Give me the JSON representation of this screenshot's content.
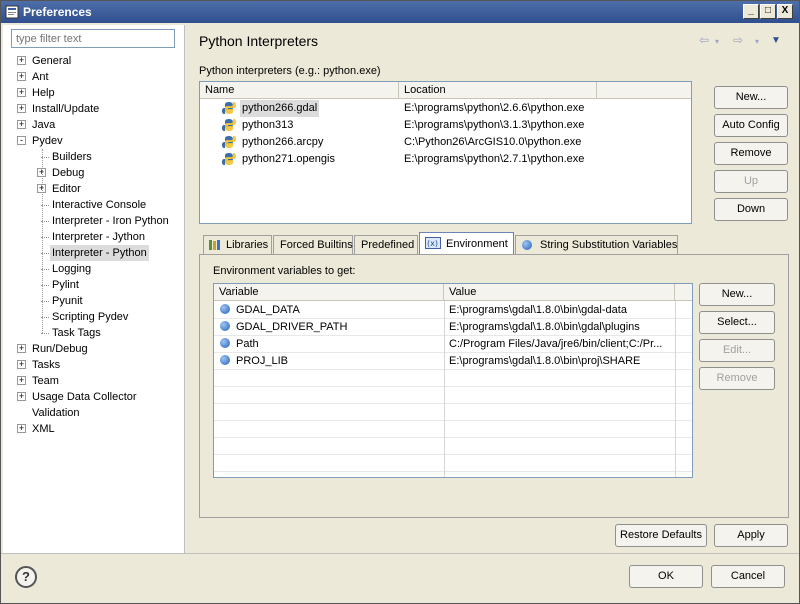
{
  "window": {
    "title": "Preferences",
    "controls": [
      "_",
      "□",
      "X"
    ]
  },
  "filter": {
    "placeholder": "type filter text"
  },
  "tree": [
    {
      "label": "General",
      "level": 0,
      "expander": "+"
    },
    {
      "label": "Ant",
      "level": 0,
      "expander": "+"
    },
    {
      "label": "Help",
      "level": 0,
      "expander": "+"
    },
    {
      "label": "Install/Update",
      "level": 0,
      "expander": "+"
    },
    {
      "label": "Java",
      "level": 0,
      "expander": "+"
    },
    {
      "label": "Pydev",
      "level": 0,
      "expander": "-"
    },
    {
      "label": "Builders",
      "level": 1,
      "expander": ""
    },
    {
      "label": "Debug",
      "level": 1,
      "expander": "+"
    },
    {
      "label": "Editor",
      "level": 1,
      "expander": "+"
    },
    {
      "label": "Interactive Console",
      "level": 1,
      "expander": ""
    },
    {
      "label": "Interpreter - Iron Python",
      "level": 1,
      "expander": ""
    },
    {
      "label": "Interpreter - Jython",
      "level": 1,
      "expander": ""
    },
    {
      "label": "Interpreter - Python",
      "level": 1,
      "expander": "",
      "selected": true
    },
    {
      "label": "Logging",
      "level": 1,
      "expander": ""
    },
    {
      "label": "Pylint",
      "level": 1,
      "expander": ""
    },
    {
      "label": "Pyunit",
      "level": 1,
      "expander": ""
    },
    {
      "label": "Scripting Pydev",
      "level": 1,
      "expander": ""
    },
    {
      "label": "Task Tags",
      "level": 1,
      "expander": ""
    },
    {
      "label": "Run/Debug",
      "level": 0,
      "expander": "+"
    },
    {
      "label": "Tasks",
      "level": 0,
      "expander": "+"
    },
    {
      "label": "Team",
      "level": 0,
      "expander": "+"
    },
    {
      "label": "Usage Data Collector",
      "level": 0,
      "expander": "+"
    },
    {
      "label": "Validation",
      "level": 0,
      "expander": ""
    },
    {
      "label": "XML",
      "level": 0,
      "expander": "+"
    }
  ],
  "page": {
    "title": "Python Interpreters",
    "nav": {
      "back": "⇦",
      "forward": "⇨",
      "menu": "▼"
    },
    "interpreters_label": "Python interpreters (e.g.: python.exe)",
    "interpreters_columns": [
      "Name",
      "Location"
    ],
    "interpreters": [
      {
        "name": "python266.gdal",
        "location": "E:\\programs\\python\\2.6.6\\python.exe",
        "selected": true
      },
      {
        "name": "python313",
        "location": "E:\\programs\\python\\3.1.3\\python.exe"
      },
      {
        "name": "python266.arcpy",
        "location": "C:\\Python26\\ArcGIS10.0\\python.exe"
      },
      {
        "name": "python271.opengis",
        "location": "E:\\programs\\python\\2.7.1\\python.exe"
      }
    ],
    "interpreter_buttons": {
      "new": "New...",
      "auto_config": "Auto Config",
      "remove": "Remove",
      "up": "Up",
      "down": "Down"
    },
    "tabs": [
      {
        "label": "Libraries",
        "icon": "libraries-icon"
      },
      {
        "label": "Forced Builtins",
        "icon": ""
      },
      {
        "label": "Predefined",
        "icon": ""
      },
      {
        "label": "Environment",
        "icon": "environment-icon",
        "active": true
      },
      {
        "label": "String Substitution Variables",
        "icon": "variable-icon"
      }
    ],
    "env_label": "Environment variables to get:",
    "env_columns": [
      "Variable",
      "Value"
    ],
    "env_vars": [
      {
        "variable": "GDAL_DATA",
        "value": "E:\\programs\\gdal\\1.8.0\\bin\\gdal-data"
      },
      {
        "variable": "GDAL_DRIVER_PATH",
        "value": "E:\\programs\\gdal\\1.8.0\\bin\\gdal\\plugins"
      },
      {
        "variable": "Path",
        "value": "C:/Program Files/Java/jre6/bin/client;C:/Pr..."
      },
      {
        "variable": "PROJ_LIB",
        "value": "E:\\programs\\gdal\\1.8.0\\bin\\proj\\SHARE"
      }
    ],
    "env_buttons": {
      "new": "New...",
      "select": "Select...",
      "edit": "Edit...",
      "remove": "Remove"
    },
    "restore_defaults": "Restore Defaults",
    "apply": "Apply"
  },
  "footer": {
    "help": "?",
    "ok": "OK",
    "cancel": "Cancel"
  }
}
